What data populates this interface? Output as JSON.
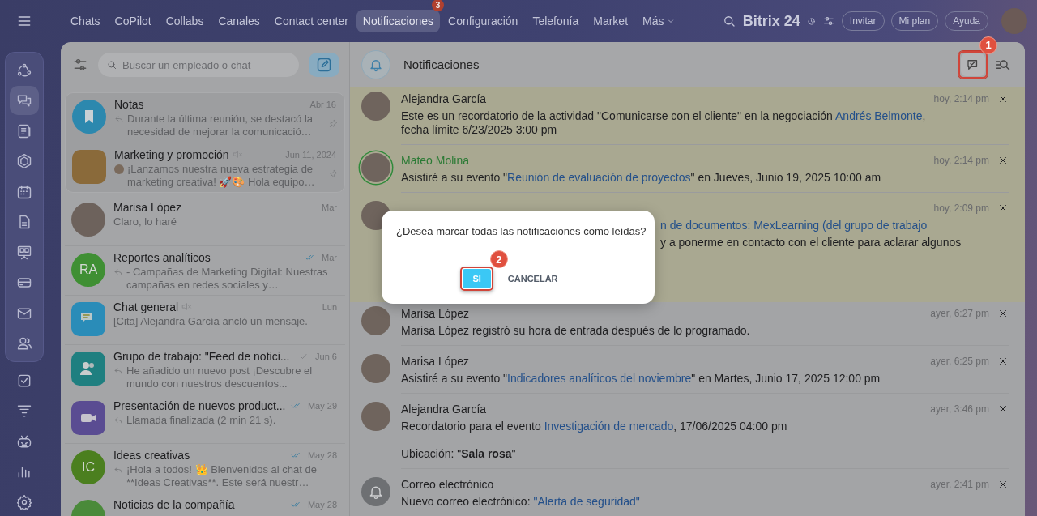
{
  "top_nav": {
    "items": [
      {
        "label": "Chats",
        "kind": "link",
        "selected": false
      },
      {
        "label": "CoPilot",
        "kind": "link",
        "selected": false
      },
      {
        "label": "Collabs",
        "kind": "link",
        "selected": false
      },
      {
        "label": "Canales",
        "kind": "link",
        "selected": false
      },
      {
        "label": "Contact center",
        "kind": "link",
        "selected": false
      },
      {
        "label": "Notificaciones",
        "kind": "link",
        "selected": true,
        "badge": "3"
      },
      {
        "label": "Configuración",
        "kind": "link",
        "selected": false
      },
      {
        "label": "Telefonía",
        "kind": "link",
        "selected": false
      },
      {
        "label": "Market",
        "kind": "link",
        "selected": false
      },
      {
        "label": "Más",
        "kind": "dropdown",
        "selected": false
      }
    ],
    "brand": "Bitrix 24",
    "buttons": [
      "Invitar",
      "Mi plan",
      "Ayuda"
    ]
  },
  "sidebar": {
    "groups": [
      {
        "framed": true,
        "items": [
          {
            "kind": "activity",
            "selected": false
          },
          {
            "kind": "chats",
            "selected": true
          },
          {
            "kind": "feed",
            "selected": false
          },
          {
            "kind": "hexagon",
            "selected": false
          },
          {
            "kind": "calendar",
            "selected": false
          },
          {
            "kind": "document",
            "selected": false
          },
          {
            "kind": "board",
            "selected": false
          },
          {
            "kind": "card",
            "selected": false
          },
          {
            "kind": "mail",
            "selected": false
          },
          {
            "kind": "people",
            "selected": false
          }
        ]
      },
      {
        "framed": false,
        "items": [
          {
            "kind": "task",
            "selected": false
          },
          {
            "kind": "funnel",
            "selected": false
          },
          {
            "kind": "robot",
            "selected": false
          },
          {
            "kind": "chart",
            "selected": false
          },
          {
            "kind": "settings",
            "selected": false
          }
        ]
      }
    ]
  },
  "chat_list": {
    "search": {
      "placeholder": "Buscar un empleado o chat"
    },
    "pinned_chats": [
      {
        "title": "Notas",
        "time": "Abr 16",
        "preview": "Durante la última reunión, se destacó la necesidad de mejorar la comunicació…",
        "reply": true,
        "sender_avatar": false,
        "muted": false,
        "delivered": false,
        "avatar": {
          "kind": "notes",
          "color": "#2c88ae"
        }
      },
      {
        "title": "Marketing y promoción",
        "time": "Jun 11, 2024",
        "preview": "¡Lanzamos nuestra nueva estrategia de marketing creativa! 🚀🎨 Hola equipo…",
        "reply": false,
        "sender_avatar": true,
        "muted": true,
        "delivered": false,
        "avatar": {
          "kind": "photo-square"
        }
      }
    ],
    "chats": [
      {
        "title": "Marisa López",
        "time": "Mar",
        "preview": "Claro, lo haré",
        "reply": false,
        "sender_avatar": false,
        "muted": false,
        "delivered": false,
        "avatar": {
          "kind": "photo"
        }
      },
      {
        "title": "Reportes analíticos",
        "time": "Mar",
        "preview": "- Campañas de Marketing Digital: Nuestras campañas en redes sociales y…",
        "reply": true,
        "sender_avatar": false,
        "muted": false,
        "delivered": true,
        "read": true,
        "avatar": {
          "kind": "initials",
          "initials": "RA",
          "color": "#3f8f33"
        }
      },
      {
        "title": "Chat general",
        "time": "Lun",
        "preview": "[Cita] Alejandra García ancló un mensaje.",
        "reply": false,
        "sender_avatar": false,
        "muted": true,
        "delivered": false,
        "avatar": {
          "kind": "chat",
          "color": "#2a8cb8"
        }
      },
      {
        "title": "Grupo de trabajo: \"Feed de notici...",
        "time": "Jun 6",
        "preview": "He añadido un nuevo post ¡Descubre el mundo con nuestros descuentos...",
        "reply": true,
        "sender_avatar": false,
        "muted": false,
        "delivered": true,
        "read": false,
        "avatar": {
          "kind": "group",
          "color": "#1f7f80"
        }
      },
      {
        "title": "Presentación de nuevos product...",
        "time": "May 29",
        "preview": "Llamada finalizada (2 min 21 s).",
        "reply": true,
        "sender_avatar": false,
        "muted": false,
        "delivered": true,
        "read": true,
        "avatar": {
          "kind": "video",
          "color": "#5a4c92"
        }
      },
      {
        "title": "Ideas creativas",
        "time": "May 28",
        "preview": "¡Hola a todos! 👑 Bienvenidos al chat de **Ideas Creativas**. Este será nuestr…",
        "reply": true,
        "sender_avatar": false,
        "muted": false,
        "delivered": true,
        "read": true,
        "avatar": {
          "kind": "initials",
          "initials": "IC",
          "color": "#4b7f1f"
        }
      },
      {
        "title": "Noticias de la compañía",
        "time": "May 28",
        "muted": false,
        "delivered": true,
        "read": true,
        "avatar": {
          "kind": "initials",
          "color": "#4a8a3a"
        }
      }
    ]
  },
  "notifications": {
    "title": "Notificaciones",
    "actions": [
      {
        "kind": "mark-read",
        "callout": "1"
      },
      {
        "kind": "search"
      }
    ],
    "items": [
      {
        "author": "Alejandra García",
        "time": "hoy, 2:14 pm",
        "unread": true,
        "online": false,
        "kind": "person",
        "body": [
          [
            {
              "kind": "plain",
              "text": "Este es un recordatorio de la actividad \"Comunicarse con el cliente\" en la negociación "
            },
            {
              "kind": "link",
              "text": "Andrés Belmonte"
            },
            {
              "kind": "plain",
              "text": ", fecha límite 6/23/2025 3:00 pm"
            }
          ]
        ]
      },
      {
        "author": "Mateo Molina",
        "time": "hoy, 2:14 pm",
        "unread": true,
        "online": true,
        "kind": "person",
        "body": [
          [
            {
              "kind": "plain",
              "text": "Asistiré a su evento \""
            },
            {
              "kind": "link",
              "text": "Reunión de evaluación de proyectos"
            },
            {
              "kind": "plain",
              "text": "\" en Jueves, Junio 19, 2025 10:00 am"
            }
          ]
        ]
      },
      {
        "time": "hoy, 2:09 pm",
        "unread": true,
        "online": false,
        "kind": "person",
        "body": [
          [
            {
              "kind": "link",
              "text": "n de documentos: MexLearning (del grupo de trabajo"
            }
          ],
          [
            {
              "kind": "plain",
              "text": "y a ponerme en contacto con el cliente para aclarar algunos"
            }
          ]
        ]
      },
      {
        "author": "Marisa López",
        "time": "ayer, 6:27 pm",
        "unread": false,
        "online": false,
        "kind": "person",
        "body": [
          [
            {
              "kind": "plain",
              "text": "Marisa López registró su hora de entrada después de lo programado."
            }
          ]
        ]
      },
      {
        "author": "Marisa López",
        "time": "ayer, 6:25 pm",
        "unread": false,
        "online": false,
        "kind": "person",
        "body": [
          [
            {
              "kind": "plain",
              "text": "Asistiré a su evento \""
            },
            {
              "kind": "link",
              "text": "Indicadores analíticos del noviembre"
            },
            {
              "kind": "plain",
              "text": "\" en Martes, Junio 17, 2025 12:00 pm"
            }
          ]
        ]
      },
      {
        "author": "Alejandra García",
        "time": "ayer, 3:46 pm",
        "unread": false,
        "online": false,
        "kind": "person",
        "body": [
          [
            {
              "kind": "plain",
              "text": "Recordatorio para el evento "
            },
            {
              "kind": "link",
              "text": "Investigación de mercado"
            },
            {
              "kind": "plain",
              "text": ", 17/06/2025 04:00 pm"
            }
          ],
          [
            {
              "kind": "plain",
              "text": "Ubicación: \""
            },
            {
              "kind": "bold",
              "text": "Sala rosa"
            },
            {
              "kind": "plain",
              "text": "\""
            }
          ]
        ]
      },
      {
        "author": "Correo electrónico",
        "time": "ayer, 2:41 pm",
        "unread": false,
        "online": false,
        "kind": "system",
        "body": [
          [
            {
              "kind": "plain",
              "text": "Nuevo correo electrónico: "
            },
            {
              "kind": "link",
              "text": "\"Alerta de seguridad\""
            }
          ]
        ]
      }
    ]
  },
  "dialog": {
    "message": "¿Desea marcar todas las notificaciones como leídas?",
    "buttons": [
      {
        "label": "SI",
        "kind": "primary",
        "callout": "2"
      },
      {
        "label": "CANCELAR",
        "kind": "secondary"
      }
    ]
  }
}
